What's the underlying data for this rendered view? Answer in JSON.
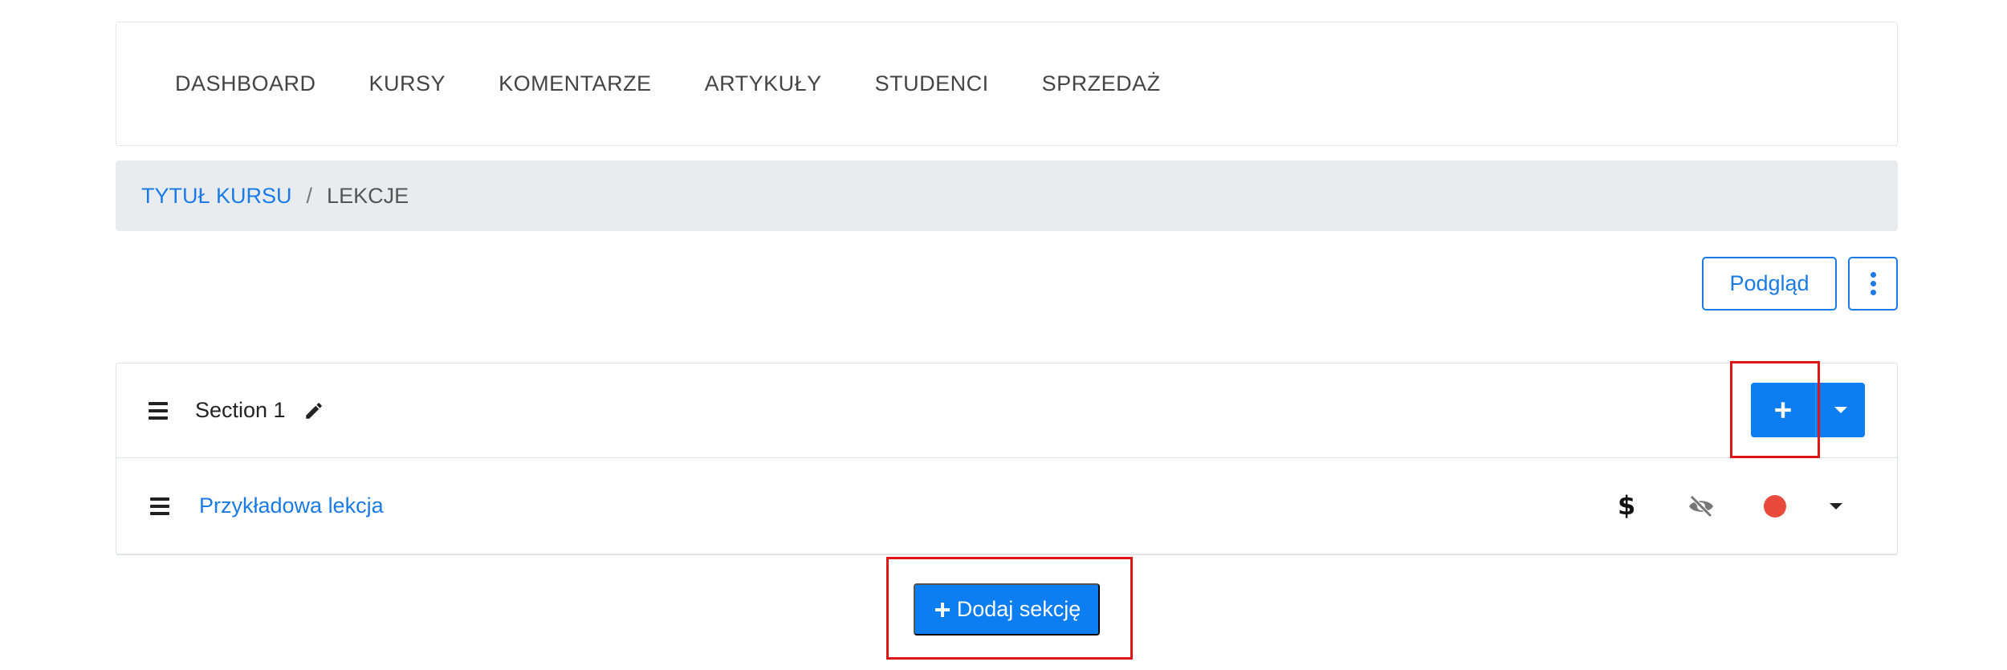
{
  "nav": {
    "items": [
      "DASHBOARD",
      "KURSY",
      "KOMENTARZE",
      "ARTYKUŁY",
      "STUDENCI",
      "SPRZEDAŻ"
    ]
  },
  "breadcrumb": {
    "link": "TYTUŁ KURSU",
    "separator": "/",
    "current": "LEKCJE"
  },
  "toolbar": {
    "preview_label": "Podgląd",
    "more_icon": "kebab-vertical-icon"
  },
  "section": {
    "title": "Section 1",
    "drag_icon": "hamburger-icon",
    "edit_icon": "pencil-icon",
    "add_icon": "plus-icon",
    "dropdown_icon": "caret-down-icon"
  },
  "lesson": {
    "title": "Przykładowa lekcja",
    "price_icon": "dollar-icon",
    "price_symbol": "$",
    "visibility_icon": "eye-slash-icon",
    "status_icon": "status-dot-icon",
    "status_color": "#e84a3c",
    "dropdown_icon": "caret-down-icon"
  },
  "add_section": {
    "label": "Dodaj sekcję",
    "icon": "plus-icon"
  },
  "colors": {
    "primary": "#0d7ef2",
    "link": "#1a7be6",
    "highlight": "#e01515",
    "breadcrumb_bg": "#e9ecef"
  }
}
